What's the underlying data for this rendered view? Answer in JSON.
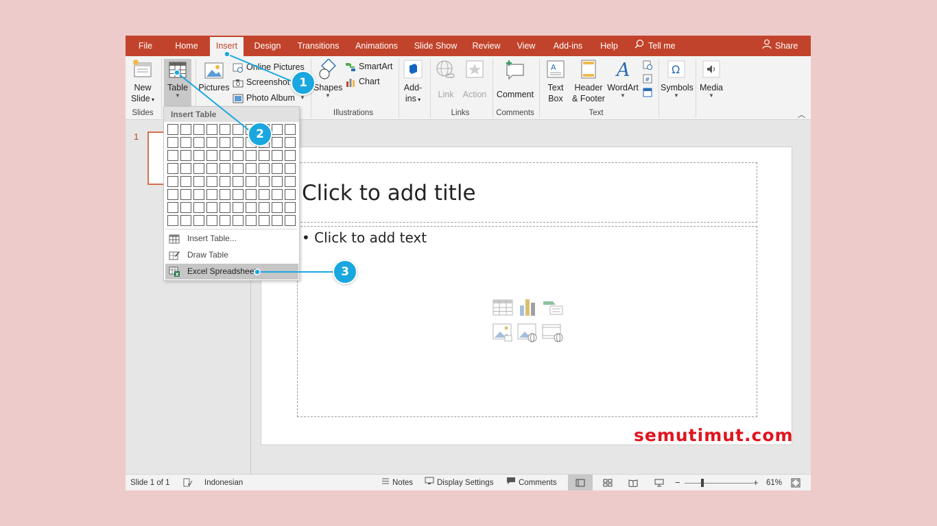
{
  "tabs": [
    {
      "label": "File"
    },
    {
      "label": "Home"
    },
    {
      "label": "Insert"
    },
    {
      "label": "Design"
    },
    {
      "label": "Transitions"
    },
    {
      "label": "Animations"
    },
    {
      "label": "Slide Show"
    },
    {
      "label": "Review"
    },
    {
      "label": "View"
    },
    {
      "label": "Add-ins"
    },
    {
      "label": "Help"
    }
  ],
  "active_tab": "Insert",
  "tell_me": "Tell me",
  "share": "Share",
  "ribbon": {
    "slides": {
      "new_slide_1": "New",
      "new_slide_2": "Slide",
      "group": "Slides"
    },
    "tables": {
      "table": "Table"
    },
    "images": {
      "pictures": "Pictures",
      "online_pictures": "Online Pictures",
      "screenshot": "Screenshot",
      "photo_album": "Photo Album"
    },
    "illustrations": {
      "shapes": "Shapes",
      "smartart": "SmartArt",
      "chart": "Chart",
      "group": "Illustrations"
    },
    "addins": {
      "line1": "Add-",
      "line2": "ins"
    },
    "links": {
      "link": "Link",
      "action": "Action",
      "group": "Links"
    },
    "comments": {
      "comment": "Comment",
      "group": "Comments"
    },
    "text": {
      "textbox_1": "Text",
      "textbox_2": "Box",
      "header_1": "Header",
      "header_2": "& Footer",
      "wordart": "WordArt",
      "group": "Text"
    },
    "symbols": "Symbols",
    "media": "Media"
  },
  "dropdown": {
    "header": "Insert Table",
    "items": [
      {
        "label": "Insert Table..."
      },
      {
        "label": "Draw Table"
      },
      {
        "label": "Excel Spreadsheet"
      }
    ]
  },
  "slide_panel": {
    "number": "1"
  },
  "slide": {
    "title_placeholder": "Click to add title",
    "body_placeholder": "• Click to add text"
  },
  "watermark": "semutimut.com",
  "statusbar": {
    "slide_info": "Slide 1 of 1",
    "language": "Indonesian",
    "notes": "Notes",
    "display_settings": "Display Settings",
    "comments": "Comments",
    "zoom": "61%",
    "zoom_level": 0.61
  },
  "callouts": [
    "1",
    "2",
    "3"
  ],
  "colors": {
    "accent": "#c2432b",
    "callout": "#1aa7e0",
    "watermark": "#e0141e"
  }
}
